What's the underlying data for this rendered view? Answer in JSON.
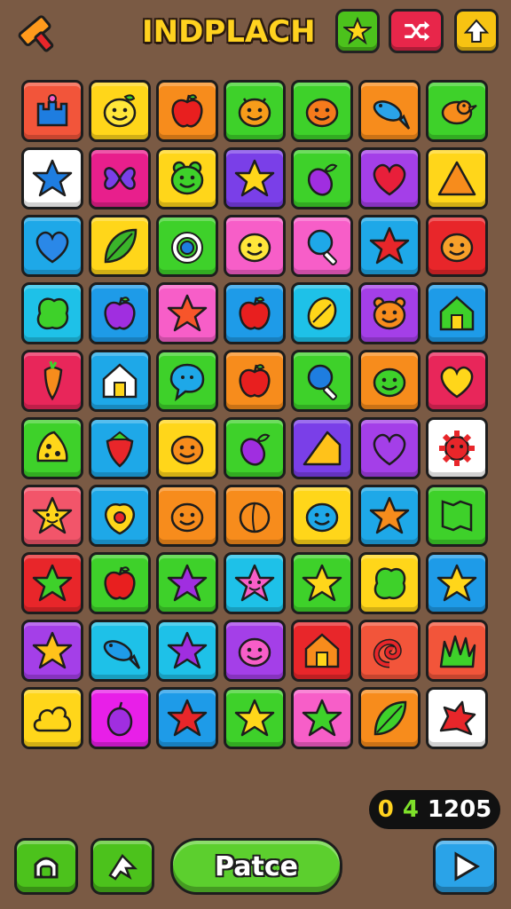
{
  "header": {
    "title": "INDPLACH",
    "buttons": [
      {
        "icon": "star-icon",
        "color": "#4cc21c"
      },
      {
        "icon": "shuffle-icon",
        "color": "#e8264a"
      },
      {
        "icon": "up-arrow-icon",
        "color": "#f7c312"
      }
    ]
  },
  "board": {
    "rows": [
      [
        {
          "color": "#f2553a",
          "icon": "castle-icon",
          "glyph": "#1e7de0"
        },
        {
          "color": "#ffd61a",
          "icon": "smiley-fruit-icon",
          "glyph": "#ffe63a"
        },
        {
          "color": "#f78c1c",
          "icon": "apple-icon",
          "glyph": "#e81f1f"
        },
        {
          "color": "#3ed12a",
          "icon": "bug-smiley-icon",
          "glyph": "#f79c1a"
        },
        {
          "color": "#3ed12a",
          "icon": "smiley-icon",
          "glyph": "#f57a1c"
        },
        {
          "color": "#f78c1c",
          "icon": "fish-icon",
          "glyph": "#2aa3e8"
        },
        {
          "color": "#3ed12a",
          "icon": "bird-icon",
          "glyph": "#f78c1c"
        }
      ],
      [
        {
          "color": "#ffffff",
          "icon": "star-icon",
          "glyph": "#1e7de0"
        },
        {
          "color": "#e81f8c",
          "icon": "butterfly-icon",
          "glyph": "#7a3fe8"
        },
        {
          "color": "#ffd61a",
          "icon": "frog-icon",
          "glyph": "#3ed12a"
        },
        {
          "color": "#7a3fe8",
          "icon": "star-icon",
          "glyph": "#ffd61a"
        },
        {
          "color": "#3ed12a",
          "icon": "eggplant-icon",
          "glyph": "#a02ee0"
        },
        {
          "color": "#a43fe8",
          "icon": "heart-icon",
          "glyph": "#e81f3a"
        },
        {
          "color": "#ffd61a",
          "icon": "triangle-icon",
          "glyph": "#f78c1c"
        }
      ],
      [
        {
          "color": "#1ea8e8",
          "icon": "heart-icon",
          "glyph": "#2a88e8"
        },
        {
          "color": "#ffd61a",
          "icon": "leaf-icon",
          "glyph": "#3ab52a"
        },
        {
          "color": "#3ed12a",
          "icon": "ring-icon",
          "glyph": "#ffffff"
        },
        {
          "color": "#f75ec8",
          "icon": "smiley-icon",
          "glyph": "#ffe63a"
        },
        {
          "color": "#f75ec8",
          "icon": "magnifier-icon",
          "glyph": "#1ea8e8"
        },
        {
          "color": "#1ea8e8",
          "icon": "star-icon",
          "glyph": "#e8262a"
        },
        {
          "color": "#e8262a",
          "icon": "smiley-icon",
          "glyph": "#f7a02a"
        }
      ],
      [
        {
          "color": "#1ec1e8",
          "icon": "blob-icon",
          "glyph": "#3ed12a"
        },
        {
          "color": "#1e9be8",
          "icon": "apple-icon",
          "glyph": "#a02ee0"
        },
        {
          "color": "#f75ec8",
          "icon": "star-icon",
          "glyph": "#f7552a"
        },
        {
          "color": "#1e9be8",
          "icon": "apple-icon",
          "glyph": "#e81f1f"
        },
        {
          "color": "#1ec1e8",
          "icon": "lemon-icon",
          "glyph": "#ffd61a"
        },
        {
          "color": "#a43fe8",
          "icon": "bear-icon",
          "glyph": "#f78c1c"
        },
        {
          "color": "#1e9be8",
          "icon": "house-icon",
          "glyph": "#3ed12a"
        }
      ],
      [
        {
          "color": "#e8265a",
          "icon": "carrot-icon",
          "glyph": "#f78c1c"
        },
        {
          "color": "#1ea8e8",
          "icon": "house-icon",
          "glyph": "#ffffff"
        },
        {
          "color": "#3ed12a",
          "icon": "speech-bubble-icon",
          "glyph": "#1ea8e8"
        },
        {
          "color": "#f78c1c",
          "icon": "apple-icon",
          "glyph": "#e81f1f"
        },
        {
          "color": "#3ed12a",
          "icon": "magnifier-icon",
          "glyph": "#1e7de0"
        },
        {
          "color": "#f78c1c",
          "icon": "smiley-icon",
          "glyph": "#3ed12a"
        },
        {
          "color": "#e8265a",
          "icon": "heart-icon",
          "glyph": "#ffd61a"
        }
      ],
      [
        {
          "color": "#3ed12a",
          "icon": "cheese-icon",
          "glyph": "#ffd61a"
        },
        {
          "color": "#1ea8e8",
          "icon": "strawberry-icon",
          "glyph": "#e8262a"
        },
        {
          "color": "#ffd61a",
          "icon": "smiley-icon",
          "glyph": "#f78c1c"
        },
        {
          "color": "#3ed12a",
          "icon": "eggplant-icon",
          "glyph": "#a02ee0"
        },
        {
          "color": "#7a3fe8",
          "icon": "cheese-wedge-icon",
          "glyph": "#ffc21a"
        },
        {
          "color": "#a43fe8",
          "icon": "heart-icon",
          "glyph": "#a43fe8"
        },
        {
          "color": "#ffffff",
          "icon": "virus-icon",
          "glyph": "#e8262a"
        }
      ],
      [
        {
          "color": "#f2556a",
          "icon": "star-smiley-icon",
          "glyph": "#ffd61a"
        },
        {
          "color": "#1ea8e8",
          "icon": "fruit-icon",
          "glyph": "#ffd61a"
        },
        {
          "color": "#f78c1c",
          "icon": "smiley-icon",
          "glyph": "#f78c1c"
        },
        {
          "color": "#f78c1c",
          "icon": "peach-icon",
          "glyph": "#f78c1c"
        },
        {
          "color": "#ffd61a",
          "icon": "smiley-icon",
          "glyph": "#1ea8e8"
        },
        {
          "color": "#1ea8e8",
          "icon": "star-icon",
          "glyph": "#f78c1c"
        },
        {
          "color": "#3ed12a",
          "icon": "map-icon",
          "glyph": "#3ed12a"
        }
      ],
      [
        {
          "color": "#e8262a",
          "icon": "star-icon",
          "glyph": "#3ed12a"
        },
        {
          "color": "#3ed12a",
          "icon": "apple-icon",
          "glyph": "#e81f1f"
        },
        {
          "color": "#3ed12a",
          "icon": "star-icon",
          "glyph": "#a02ee0"
        },
        {
          "color": "#1ec1e8",
          "icon": "star-smiley-icon",
          "glyph": "#f75ec8"
        },
        {
          "color": "#3ed12a",
          "icon": "star-icon",
          "glyph": "#ffd61a"
        },
        {
          "color": "#ffd61a",
          "icon": "blob-icon",
          "glyph": "#3ed12a"
        },
        {
          "color": "#1e9be8",
          "icon": "star-icon",
          "glyph": "#ffd61a"
        }
      ],
      [
        {
          "color": "#a43fe8",
          "icon": "star-icon",
          "glyph": "#ffc21a"
        },
        {
          "color": "#1ec1e8",
          "icon": "fish-icon",
          "glyph": "#1e9be8"
        },
        {
          "color": "#1ec1e8",
          "icon": "star-icon",
          "glyph": "#a02ee0"
        },
        {
          "color": "#a43fe8",
          "icon": "smiley-icon",
          "glyph": "#f75ec8"
        },
        {
          "color": "#e8262a",
          "icon": "house-icon",
          "glyph": "#f78c1c"
        },
        {
          "color": "#f2553a",
          "icon": "swirl-icon",
          "glyph": "#e8262a"
        },
        {
          "color": "#f2553a",
          "icon": "grass-icon",
          "glyph": "#3ed12a"
        }
      ],
      [
        {
          "color": "#ffd61a",
          "icon": "cloud-icon",
          "glyph": "#ffd61a"
        },
        {
          "color": "#e81fe8",
          "icon": "plum-icon",
          "glyph": "#a02ee0"
        },
        {
          "color": "#1e9be8",
          "icon": "star-icon",
          "glyph": "#e8262a"
        },
        {
          "color": "#3ed12a",
          "icon": "star-icon",
          "glyph": "#ffd61a"
        },
        {
          "color": "#f75ec8",
          "icon": "star-icon",
          "glyph": "#3ed12a"
        },
        {
          "color": "#f78c1c",
          "icon": "leaf-icon",
          "glyph": "#3ed12a"
        },
        {
          "color": "#ffffff",
          "icon": "splat-icon",
          "glyph": "#e8262a"
        }
      ]
    ]
  },
  "score": {
    "a": "0",
    "b": "4",
    "c": "1205"
  },
  "footer": {
    "left_button": {
      "icon": "home-icon",
      "color": "#4cc21c"
    },
    "mid_button": {
      "icon": "draw-icon",
      "color": "#4cc21c"
    },
    "pause_label": "Patce",
    "pause_color": "#5ccf2e",
    "play_button": {
      "icon": "play-icon",
      "color": "#2aa3e8"
    }
  }
}
